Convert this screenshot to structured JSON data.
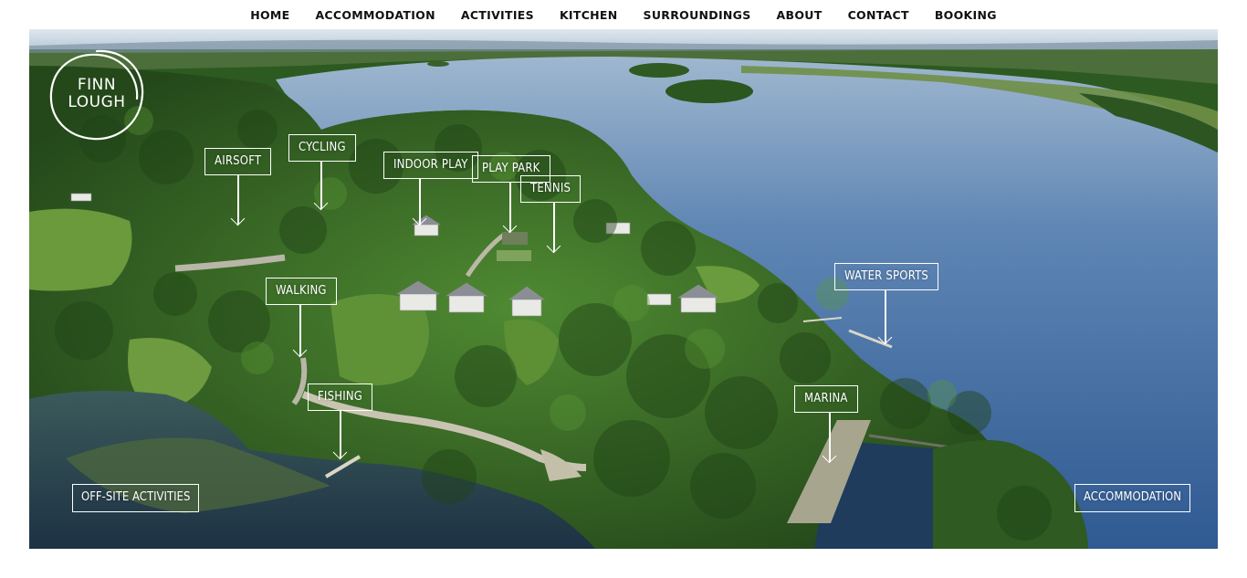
{
  "nav": {
    "items": [
      "HOME",
      "ACCOMMODATION",
      "ACTIVITIES",
      "KITCHEN",
      "SURROUNDINGS",
      "ABOUT",
      "CONTACT",
      "BOOKING"
    ]
  },
  "logo": {
    "line1": "FINN",
    "line2": "LOUGH"
  },
  "map_tags": {
    "airsoft": "AIRSOFT",
    "cycling": "CYCLING",
    "indoor_play": "INDOOR PLAY",
    "play_park": "PLAY PARK",
    "tennis": "TENNIS",
    "walking": "WALKING",
    "water_sports": "WATER SPORTS",
    "fishing": "FISHING",
    "marina": "MARINA"
  },
  "links": {
    "offsite": "OFF-SITE ACTIVITIES",
    "accommodation": "ACCOMMODATION"
  },
  "colors": {
    "lake": "#3f6fa8",
    "forest": "#2f5d22",
    "meadow": "#5f8f3a",
    "sky": "#c9d8e6",
    "tag_border": "#ffffff",
    "nav_text": "#111111"
  }
}
